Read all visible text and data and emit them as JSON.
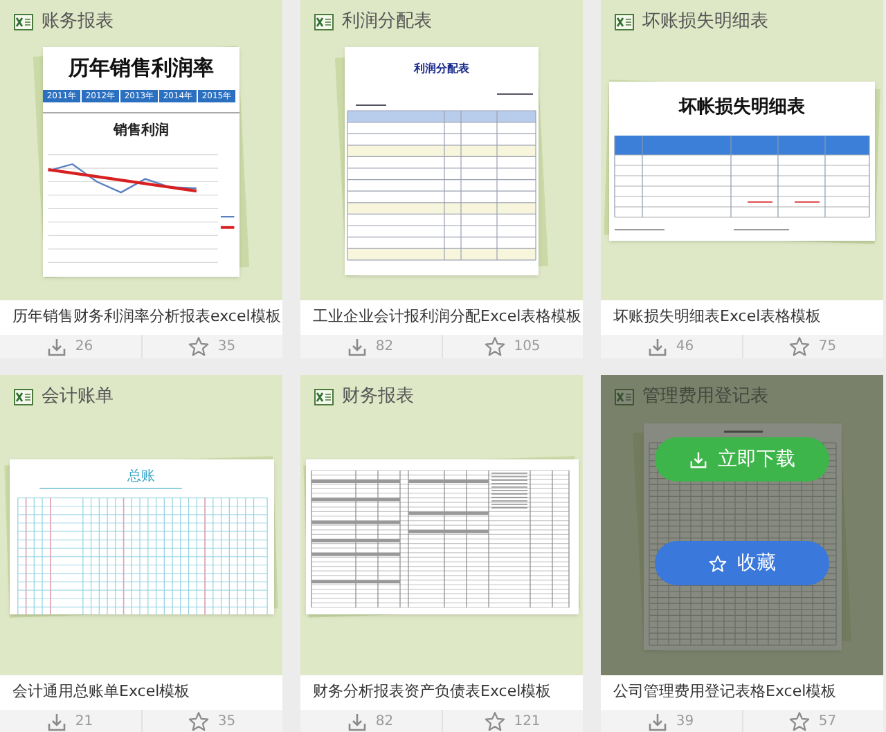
{
  "cards": [
    {
      "category": "账务报表",
      "preview": {
        "kind": "chart",
        "title": "历年销售利润率",
        "years": [
          "2011年",
          "2012年",
          "2013年",
          "2014年",
          "2015年"
        ],
        "chart_title": "销售利润"
      },
      "title": "历年销售财务利润率分析报表excel模板",
      "downloads": "26",
      "favorites": "35",
      "hovered": false
    },
    {
      "category": "利润分配表",
      "preview": {
        "kind": "table",
        "title": "利润分配表"
      },
      "title": "工业企业会计报利润分配Excel表格模板",
      "downloads": "82",
      "favorites": "105",
      "hovered": false
    },
    {
      "category": "坏账损失明细表",
      "preview": {
        "kind": "detail",
        "title": "坏帐损失明细表"
      },
      "title": "坏账损失明细表Excel表格模板",
      "downloads": "46",
      "favorites": "75",
      "hovered": false
    },
    {
      "category": "会计账单",
      "preview": {
        "kind": "ledger",
        "title": "总账"
      },
      "title": "会计通用总账单Excel模板",
      "downloads": "21",
      "favorites": "35",
      "hovered": false
    },
    {
      "category": "财务报表",
      "preview": {
        "kind": "sheet"
      },
      "title": "财务分析报表资产负债表Excel模板",
      "downloads": "82",
      "favorites": "121",
      "hovered": false
    },
    {
      "category": "管理费用登记表",
      "preview": {
        "kind": "grid"
      },
      "title": "公司管理费用登记表格Excel模板",
      "downloads": "39",
      "favorites": "57",
      "hovered": true,
      "actions": [
        {
          "kind": "download",
          "label": "立即下载"
        },
        {
          "kind": "favorite",
          "label": "收藏"
        }
      ]
    }
  ]
}
